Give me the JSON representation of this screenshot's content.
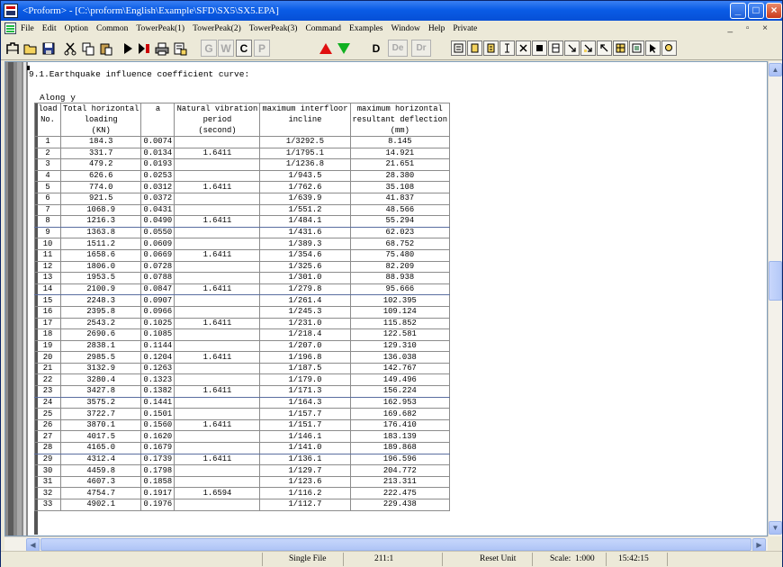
{
  "window": {
    "title": "<Proform> - [C:\\proform\\English\\Example\\SFD\\SX5\\SX5.EPA]",
    "controls": {
      "minimize": "_",
      "maximize": "□",
      "close": "×"
    }
  },
  "menu": {
    "items": [
      "File",
      "Edit",
      "Option",
      "Common",
      "TowerPeak(1)",
      "TowerPeak(2)",
      "TowerPeak(3)",
      "Command",
      "Examples",
      "Window",
      "Help",
      "Private"
    ],
    "mdi_controls": "_ ▫ ×"
  },
  "toolbar": {
    "text_buttons": {
      "g": "G",
      "w": "W",
      "c": "C",
      "p": "P",
      "d": "D",
      "de": "De",
      "dr": "Dr"
    }
  },
  "document": {
    "section_title": "9.1.Earthquake influence coefficient curve:",
    "along_label": "Along y",
    "columns": [
      [
        "load",
        "No."
      ],
      [
        "Total horizontal",
        "loading",
        "(KN)"
      ],
      [
        "a"
      ],
      [
        "Natural vibration",
        "period",
        "(second)"
      ],
      [
        "maximum interfloor",
        "incline"
      ],
      [
        "maximum horizontal",
        "resultant deflection",
        "(mm)"
      ]
    ],
    "rows": [
      [
        "1",
        "184.3",
        "0.0074",
        "",
        "1/3292.5",
        "8.145"
      ],
      [
        "2",
        "331.7",
        "0.0134",
        "1.6411",
        "1/1795.1",
        "14.921"
      ],
      [
        "3",
        "479.2",
        "0.0193",
        "",
        "1/1236.8",
        "21.651"
      ],
      [
        "4",
        "626.6",
        "0.0253",
        "",
        "1/943.5",
        "28.380"
      ],
      [
        "5",
        "774.0",
        "0.0312",
        "1.6411",
        "1/762.6",
        "35.108"
      ],
      [
        "6",
        "921.5",
        "0.0372",
        "",
        "1/639.9",
        "41.837"
      ],
      [
        "7",
        "1068.9",
        "0.0431",
        "",
        "1/551.2",
        "48.566"
      ],
      [
        "8",
        "1216.3",
        "0.0490",
        "1.6411",
        "1/484.1",
        "55.294"
      ],
      [
        "9",
        "1363.8",
        "0.0550",
        "",
        "1/431.6",
        "62.023"
      ],
      [
        "10",
        "1511.2",
        "0.0609",
        "",
        "1/389.3",
        "68.752"
      ],
      [
        "11",
        "1658.6",
        "0.0669",
        "1.6411",
        "1/354.6",
        "75.480"
      ],
      [
        "12",
        "1806.0",
        "0.0728",
        "",
        "1/325.6",
        "82.209"
      ],
      [
        "13",
        "1953.5",
        "0.0788",
        "",
        "1/301.0",
        "88.938"
      ],
      [
        "14",
        "2100.9",
        "0.0847",
        "1.6411",
        "1/279.8",
        "95.666"
      ],
      [
        "15",
        "2248.3",
        "0.0907",
        "",
        "1/261.4",
        "102.395"
      ],
      [
        "16",
        "2395.8",
        "0.0966",
        "",
        "1/245.3",
        "109.124"
      ],
      [
        "17",
        "2543.2",
        "0.1025",
        "1.6411",
        "1/231.0",
        "115.852"
      ],
      [
        "18",
        "2690.6",
        "0.1085",
        "",
        "1/218.4",
        "122.581"
      ],
      [
        "19",
        "2838.1",
        "0.1144",
        "",
        "1/207.0",
        "129.310"
      ],
      [
        "20",
        "2985.5",
        "0.1204",
        "1.6411",
        "1/196.8",
        "136.038"
      ],
      [
        "21",
        "3132.9",
        "0.1263",
        "",
        "1/187.5",
        "142.767"
      ],
      [
        "22",
        "3280.4",
        "0.1323",
        "",
        "1/179.0",
        "149.496"
      ],
      [
        "23",
        "3427.8",
        "0.1382",
        "1.6411",
        "1/171.3",
        "156.224"
      ],
      [
        "24",
        "3575.2",
        "0.1441",
        "",
        "1/164.3",
        "162.953"
      ],
      [
        "25",
        "3722.7",
        "0.1501",
        "",
        "1/157.7",
        "169.682"
      ],
      [
        "26",
        "3870.1",
        "0.1560",
        "1.6411",
        "1/151.7",
        "176.410"
      ],
      [
        "27",
        "4017.5",
        "0.1620",
        "",
        "1/146.1",
        "183.139"
      ],
      [
        "28",
        "4165.0",
        "0.1679",
        "",
        "1/141.0",
        "189.868"
      ],
      [
        "29",
        "4312.4",
        "0.1739",
        "1.6411",
        "1/136.1",
        "196.596"
      ],
      [
        "30",
        "4459.8",
        "0.1798",
        "",
        "1/129.7",
        "204.772"
      ],
      [
        "31",
        "4607.3",
        "0.1858",
        "",
        "1/123.6",
        "213.311"
      ],
      [
        "32",
        "4754.7",
        "0.1917",
        "1.6594",
        "1/116.2",
        "222.475"
      ],
      [
        "33",
        "4902.1",
        "0.1976",
        "",
        "1/112.7",
        "229.438"
      ]
    ]
  },
  "statusbar": {
    "mode": "Single File",
    "position": "211:1",
    "unit": "Reset Unit",
    "scale_label": "Scale:",
    "scale_value": "1:000",
    "time": "15:42:15"
  },
  "colors": {
    "titlebar": "#0a5ce6",
    "chrome": "#ece9d8",
    "up_arrow": "#e01010",
    "down_arrow": "#10b020"
  }
}
